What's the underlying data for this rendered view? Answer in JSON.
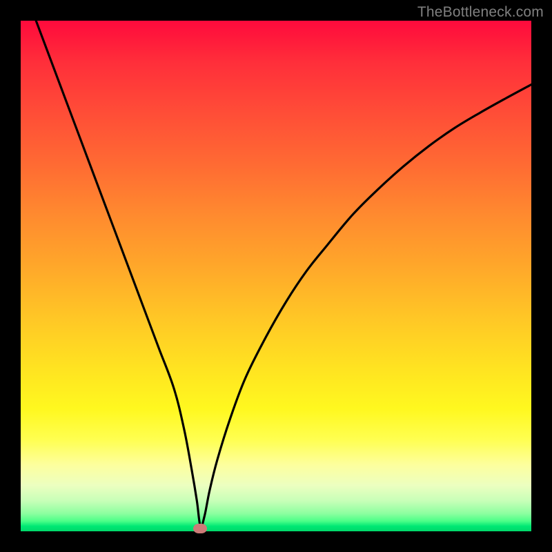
{
  "watermark": "TheBottleneck.com",
  "chart_data": {
    "type": "line",
    "title": "",
    "xlabel": "",
    "ylabel": "",
    "xlim": [
      0,
      100
    ],
    "ylim": [
      0,
      100
    ],
    "x": [
      0,
      3,
      6,
      9,
      12,
      15,
      18,
      21,
      24,
      27,
      30,
      32,
      33.5,
      34.5,
      35.2,
      36,
      37,
      38.5,
      41,
      44,
      48,
      52,
      56,
      60,
      65,
      70,
      75,
      80,
      85,
      90,
      95,
      100
    ],
    "values": [
      108,
      100,
      92,
      84,
      76,
      68,
      60,
      52,
      44,
      36,
      28,
      20,
      12,
      6,
      1,
      3,
      8,
      14,
      22,
      30,
      38,
      45,
      51,
      56,
      62,
      67,
      71.5,
      75.5,
      79,
      82,
      84.8,
      87.5
    ],
    "marker": {
      "x": 35.2,
      "y": 0.6
    },
    "background_gradient": {
      "top": "#ff0a3c",
      "mid": "#ffe321",
      "bottom": "#00d86a"
    },
    "curve_color": "#000000",
    "marker_color": "#cc7b78"
  }
}
